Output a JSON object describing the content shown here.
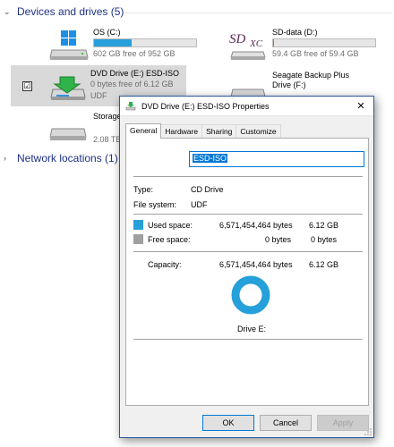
{
  "explorer": {
    "devices_group": {
      "title": "Devices and drives (5)"
    },
    "network_group": {
      "title": "Network locations (1)"
    },
    "drives": [
      {
        "name": "OS (C:)",
        "info": "602 GB free of 952 GB",
        "used_fraction": 0.37,
        "icon": "windows-drive-icon"
      },
      {
        "name": "SD-data (D:)",
        "info": "59.4 GB free of 59.4 GB",
        "used_fraction": 0.01,
        "icon": "sdxc-card-icon",
        "icon_text": "SDXC"
      },
      {
        "name": "DVD Drive (E:) ESD-ISO",
        "info": "0 bytes free of 6.12 GB",
        "info2": "UDF",
        "used_fraction": 1.0,
        "icon": "dvd-drive-icon"
      },
      {
        "name": "Seagate Backup Plus",
        "name2": "Drive (F:)",
        "icon": "external-drive-icon"
      },
      {
        "name": "Storage",
        "info": "2.08 TB",
        "icon": "hard-drive-icon"
      }
    ],
    "checkbox_mark": "☑"
  },
  "dialog": {
    "title": "DVD Drive (E:) ESD-ISO Properties",
    "close_glyph": "✕",
    "tabs": [
      "General",
      "Hardware",
      "Sharing",
      "Customize"
    ],
    "active_tab": "General",
    "volume_label": "ESD-ISO",
    "type_label": "Type:",
    "type_value": "CD Drive",
    "fs_label": "File system:",
    "fs_value": "UDF",
    "used": {
      "label": "Used space:",
      "bytes": "6,571,454,464 bytes",
      "size": "6.12 GB",
      "color": "#26a0da"
    },
    "free": {
      "label": "Free space:",
      "bytes": "0 bytes",
      "size": "0 bytes",
      "color": "#a0a0a0"
    },
    "capacity": {
      "label": "Capacity:",
      "bytes": "6,571,454,464 bytes",
      "size": "6.12 GB"
    },
    "drive_caption": "Drive E:",
    "buttons": {
      "ok": "OK",
      "cancel": "Cancel",
      "apply": "Apply"
    }
  }
}
